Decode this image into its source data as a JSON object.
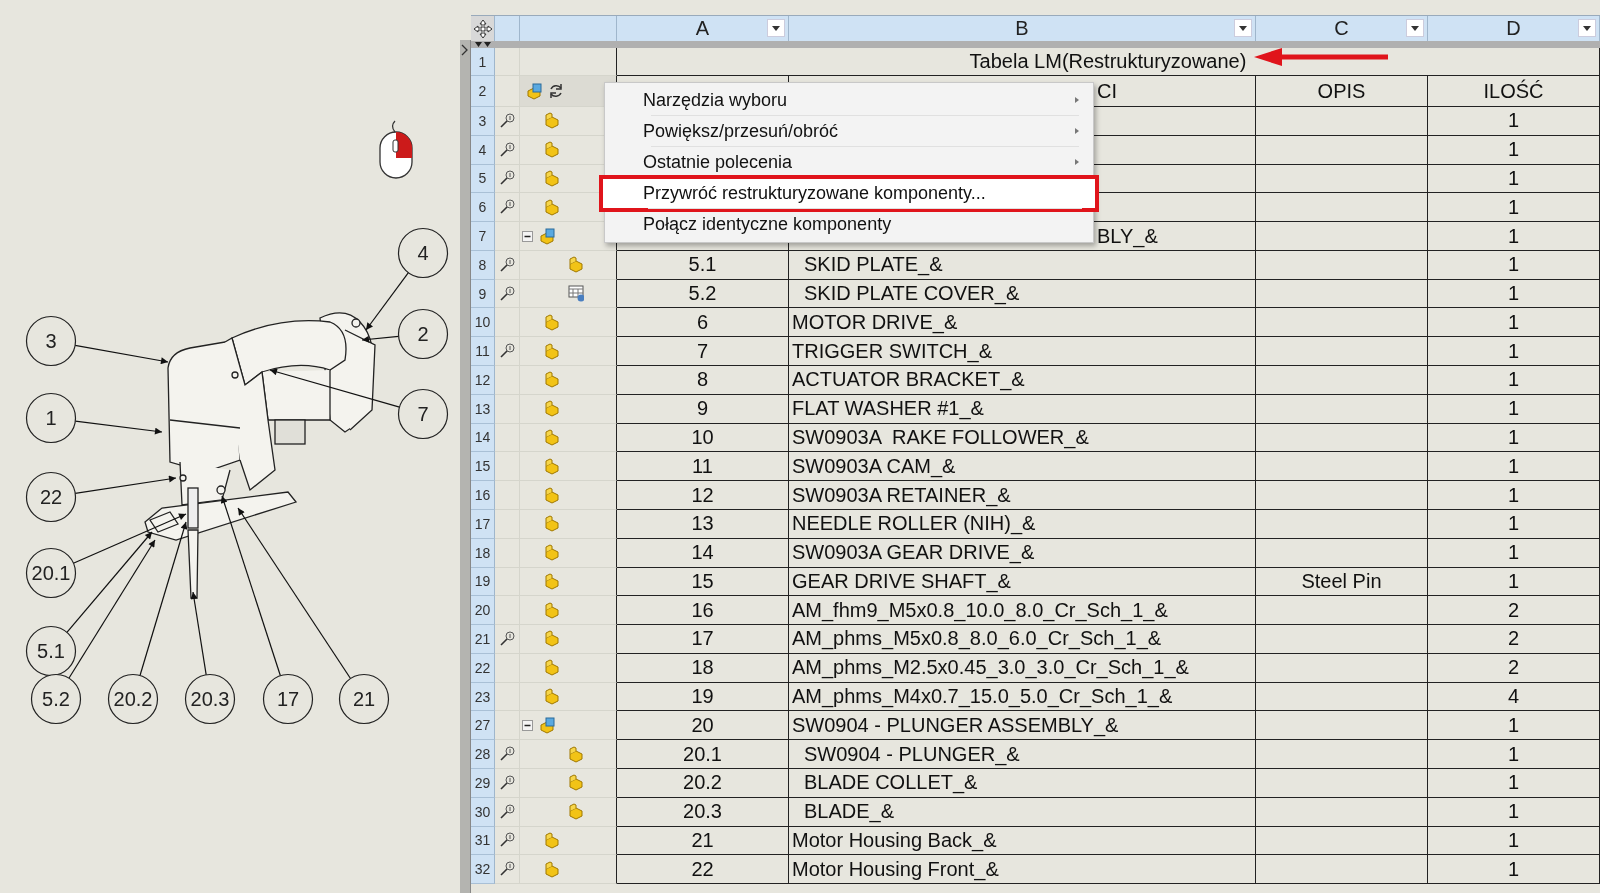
{
  "drawing": {
    "balloons": [
      {
        "label": "4"
      },
      {
        "label": "2"
      },
      {
        "label": "7"
      },
      {
        "label": "3"
      },
      {
        "label": "1"
      },
      {
        "label": "22"
      },
      {
        "label": "20.1"
      },
      {
        "label": "5.1"
      },
      {
        "label": "5.2"
      },
      {
        "label": "20.2"
      },
      {
        "label": "20.3"
      },
      {
        "label": "17"
      },
      {
        "label": "21"
      }
    ]
  },
  "table": {
    "columns": [
      {
        "label": "A"
      },
      {
        "label": "B"
      },
      {
        "label": "C"
      },
      {
        "label": "D"
      }
    ],
    "title_row": {
      "row_number": "1",
      "title": "Tabela LM(Restrukturyzowane)"
    },
    "header_row": {
      "row_number": "2",
      "B": "CI",
      "C": "OPIS",
      "D": "ILOŚĆ"
    },
    "rows": [
      {
        "row_number": "3",
        "magnifier": true,
        "kind": "part",
        "D": "1"
      },
      {
        "row_number": "4",
        "magnifier": true,
        "kind": "part",
        "D": "1"
      },
      {
        "row_number": "5",
        "magnifier": true,
        "kind": "part",
        "D": "1"
      },
      {
        "row_number": "6",
        "magnifier": true,
        "kind": "part",
        "D": "1"
      },
      {
        "row_number": "7",
        "magnifier": false,
        "kind": "assembly",
        "expanded": true,
        "B": "BLY_&",
        "D": "1",
        "children": [
          {
            "row_number": "8",
            "magnifier": true,
            "kind": "part",
            "A": "5.1",
            "B": "SKID PLATE_&",
            "D": "1"
          },
          {
            "row_number": "9",
            "magnifier": true,
            "kind": "table-part",
            "A": "5.2",
            "B": "SKID PLATE COVER_&",
            "D": "1"
          }
        ]
      },
      {
        "row_number": "10",
        "magnifier": false,
        "kind": "part",
        "A": "6",
        "B": "MOTOR DRIVE_&",
        "D": "1"
      },
      {
        "row_number": "11",
        "magnifier": true,
        "kind": "part",
        "A": "7",
        "B": "TRIGGER SWITCH_&",
        "D": "1"
      },
      {
        "row_number": "12",
        "magnifier": false,
        "kind": "part",
        "A": "8",
        "B": "ACTUATOR BRACKET_&",
        "D": "1"
      },
      {
        "row_number": "13",
        "magnifier": false,
        "kind": "part",
        "A": "9",
        "B": "FLAT WASHER #1_&",
        "D": "1"
      },
      {
        "row_number": "14",
        "magnifier": false,
        "kind": "part",
        "A": "10",
        "B": "SW0903A  RAKE FOLLOWER_&",
        "D": "1"
      },
      {
        "row_number": "15",
        "magnifier": false,
        "kind": "part",
        "A": "11",
        "B": "SW0903A CAM_&",
        "D": "1"
      },
      {
        "row_number": "16",
        "magnifier": false,
        "kind": "part",
        "A": "12",
        "B": "SW0903A RETAINER_&",
        "D": "1"
      },
      {
        "row_number": "17",
        "magnifier": false,
        "kind": "part",
        "A": "13",
        "B": "NEEDLE ROLLER (NIH)_&",
        "D": "1"
      },
      {
        "row_number": "18",
        "magnifier": false,
        "kind": "part",
        "A": "14",
        "B": "SW0903A GEAR DRIVE_&",
        "D": "1"
      },
      {
        "row_number": "19",
        "magnifier": false,
        "kind": "part",
        "A": "15",
        "B": "GEAR DRIVE SHAFT_&",
        "C": "Steel Pin",
        "D": "1"
      },
      {
        "row_number": "20",
        "magnifier": false,
        "kind": "part",
        "A": "16",
        "B": "AM_fhm9_M5x0.8_10.0_8.0_Cr_Sch_1_&",
        "D": "2"
      },
      {
        "row_number": "21",
        "magnifier": true,
        "kind": "part",
        "A": "17",
        "B": "AM_phms_M5x0.8_8.0_6.0_Cr_Sch_1_&",
        "D": "2"
      },
      {
        "row_number": "22",
        "magnifier": false,
        "kind": "part",
        "A": "18",
        "B": "AM_phms_M2.5x0.45_3.0_3.0_Cr_Sch_1_&",
        "D": "2"
      },
      {
        "row_number": "23",
        "magnifier": false,
        "kind": "part",
        "A": "19",
        "B": "AM_phms_M4x0.7_15.0_5.0_Cr_Sch_1_&",
        "D": "4"
      },
      {
        "row_number": "27",
        "magnifier": false,
        "kind": "assembly",
        "expanded": true,
        "A": "20",
        "B": "SW0904 - PLUNGER ASSEMBLY_&",
        "D": "1",
        "children": [
          {
            "row_number": "28",
            "magnifier": true,
            "kind": "part",
            "A": "20.1",
            "B": "SW0904 - PLUNGER_&",
            "D": "1"
          },
          {
            "row_number": "29",
            "magnifier": true,
            "kind": "part",
            "A": "20.2",
            "B": "BLADE COLLET_&",
            "D": "1"
          },
          {
            "row_number": "30",
            "magnifier": true,
            "kind": "part",
            "A": "20.3",
            "B": "BLADE_&",
            "D": "1"
          }
        ]
      },
      {
        "row_number": "31",
        "magnifier": true,
        "kind": "part",
        "A": "21",
        "B": "Motor Housing Back_&",
        "D": "1"
      },
      {
        "row_number": "32",
        "magnifier": true,
        "kind": "part",
        "A": "22",
        "B": "Motor Housing Front_&",
        "D": "1"
      }
    ]
  },
  "context_menu": {
    "items": [
      {
        "label": "Narzędzia wyboru",
        "submenu": true,
        "highlighted": false
      },
      {
        "label": "Powiększ/przesuń/obróć",
        "submenu": true,
        "highlighted": false
      },
      {
        "label": "Ostatnie polecenia",
        "submenu": true,
        "highlighted": false
      },
      {
        "label": "Przywróć restrukturyzowane komponenty...",
        "submenu": false,
        "highlighted": true
      },
      {
        "label": "Połącz identyczne komponenty",
        "submenu": false,
        "highlighted": false
      }
    ]
  }
}
